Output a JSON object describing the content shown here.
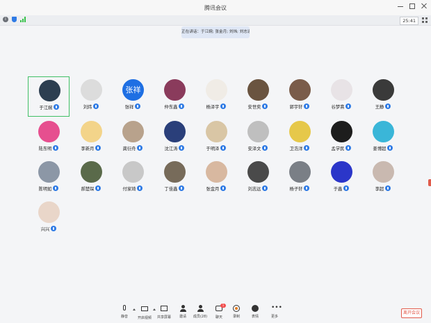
{
  "window": {
    "title": "腾讯会议"
  },
  "status": {
    "timer": "25:41"
  },
  "speaking": {
    "text": "正在讲话：于江婉; 张金月; 刘炜; 刘志远..."
  },
  "participants": [
    {
      "name": "于江婉",
      "color": "#2c3e50"
    },
    {
      "name": "刘炜",
      "color": "#dcdcdc"
    },
    {
      "name": "张祥",
      "avatar_text": "张祥",
      "color": "#1e6fe3"
    },
    {
      "name": "仲东鑫",
      "color": "#8a3b5c"
    },
    {
      "name": "杨泽宇",
      "color": "#f0ece6"
    },
    {
      "name": "安世奕",
      "color": "#6a5440"
    },
    {
      "name": "郭宇轩",
      "color": "#7a5c4a"
    },
    {
      "name": "谷梦熹",
      "color": "#e8e3e6"
    },
    {
      "name": "王静",
      "color": "#3a3a3a"
    },
    {
      "name": "陆东明",
      "color": "#e64f8f"
    },
    {
      "name": "李新月",
      "color": "#f3d48a"
    },
    {
      "name": "龚衍舟",
      "color": "#b8a28c"
    },
    {
      "name": "沈江涛",
      "color": "#2a3f7a"
    },
    {
      "name": "于明泽",
      "color": "#d9c6a5"
    },
    {
      "name": "安泽文",
      "color": "#bfbfbf"
    },
    {
      "name": "卫浩洋",
      "color": "#e6c84a"
    },
    {
      "name": "孟学民",
      "color": "#1d1d1d"
    },
    {
      "name": "姜博超",
      "color": "#3ab6d8"
    },
    {
      "name": "陈明如",
      "color": "#8c97a6"
    },
    {
      "name": "郝楚琛",
      "color": "#5a6a4a"
    },
    {
      "name": "付家琦",
      "color": "#c8c8c8"
    },
    {
      "name": "丁佳鑫",
      "color": "#776b5a"
    },
    {
      "name": "张金月",
      "color": "#d8b8a0"
    },
    {
      "name": "刘志远",
      "color": "#4a4a4a"
    },
    {
      "name": "杨子轩",
      "color": "#7a7f86"
    },
    {
      "name": "于鑫",
      "color": "#2b36c9"
    },
    {
      "name": "李超",
      "color": "#c9b9b0"
    },
    {
      "name": "兴兴",
      "color": "#e9d6c9"
    }
  ],
  "toolbar": [
    {
      "label": "静音",
      "icon": "microphone-icon"
    },
    {
      "label": "开启视频",
      "icon": "camera-off-icon"
    },
    {
      "label": "共享屏幕",
      "icon": "share-screen-icon"
    },
    {
      "label": "邀请",
      "icon": "invite-icon"
    },
    {
      "label": "成员(28)",
      "icon": "members-icon"
    },
    {
      "label": "聊天",
      "icon": "chat-icon",
      "badge": "1"
    },
    {
      "label": "录制",
      "icon": "record-icon"
    },
    {
      "label": "表情",
      "icon": "emoji-icon"
    },
    {
      "label": "更多",
      "icon": "more-icon"
    }
  ],
  "leave": {
    "label": "离开会议"
  }
}
